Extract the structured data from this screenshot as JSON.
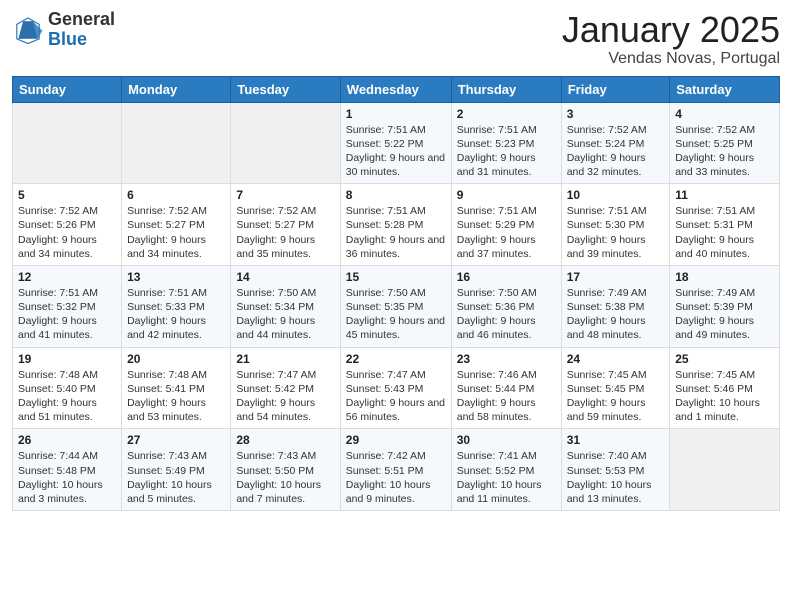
{
  "header": {
    "logo_general": "General",
    "logo_blue": "Blue",
    "title": "January 2025",
    "location": "Vendas Novas, Portugal"
  },
  "weekdays": [
    "Sunday",
    "Monday",
    "Tuesday",
    "Wednesday",
    "Thursday",
    "Friday",
    "Saturday"
  ],
  "weeks": [
    [
      {
        "day": "",
        "content": ""
      },
      {
        "day": "",
        "content": ""
      },
      {
        "day": "",
        "content": ""
      },
      {
        "day": "1",
        "content": "Sunrise: 7:51 AM\nSunset: 5:22 PM\nDaylight: 9 hours and 30 minutes."
      },
      {
        "day": "2",
        "content": "Sunrise: 7:51 AM\nSunset: 5:23 PM\nDaylight: 9 hours and 31 minutes."
      },
      {
        "day": "3",
        "content": "Sunrise: 7:52 AM\nSunset: 5:24 PM\nDaylight: 9 hours and 32 minutes."
      },
      {
        "day": "4",
        "content": "Sunrise: 7:52 AM\nSunset: 5:25 PM\nDaylight: 9 hours and 33 minutes."
      }
    ],
    [
      {
        "day": "5",
        "content": "Sunrise: 7:52 AM\nSunset: 5:26 PM\nDaylight: 9 hours and 34 minutes."
      },
      {
        "day": "6",
        "content": "Sunrise: 7:52 AM\nSunset: 5:27 PM\nDaylight: 9 hours and 34 minutes."
      },
      {
        "day": "7",
        "content": "Sunrise: 7:52 AM\nSunset: 5:27 PM\nDaylight: 9 hours and 35 minutes."
      },
      {
        "day": "8",
        "content": "Sunrise: 7:51 AM\nSunset: 5:28 PM\nDaylight: 9 hours and 36 minutes."
      },
      {
        "day": "9",
        "content": "Sunrise: 7:51 AM\nSunset: 5:29 PM\nDaylight: 9 hours and 37 minutes."
      },
      {
        "day": "10",
        "content": "Sunrise: 7:51 AM\nSunset: 5:30 PM\nDaylight: 9 hours and 39 minutes."
      },
      {
        "day": "11",
        "content": "Sunrise: 7:51 AM\nSunset: 5:31 PM\nDaylight: 9 hours and 40 minutes."
      }
    ],
    [
      {
        "day": "12",
        "content": "Sunrise: 7:51 AM\nSunset: 5:32 PM\nDaylight: 9 hours and 41 minutes."
      },
      {
        "day": "13",
        "content": "Sunrise: 7:51 AM\nSunset: 5:33 PM\nDaylight: 9 hours and 42 minutes."
      },
      {
        "day": "14",
        "content": "Sunrise: 7:50 AM\nSunset: 5:34 PM\nDaylight: 9 hours and 44 minutes."
      },
      {
        "day": "15",
        "content": "Sunrise: 7:50 AM\nSunset: 5:35 PM\nDaylight: 9 hours and 45 minutes."
      },
      {
        "day": "16",
        "content": "Sunrise: 7:50 AM\nSunset: 5:36 PM\nDaylight: 9 hours and 46 minutes."
      },
      {
        "day": "17",
        "content": "Sunrise: 7:49 AM\nSunset: 5:38 PM\nDaylight: 9 hours and 48 minutes."
      },
      {
        "day": "18",
        "content": "Sunrise: 7:49 AM\nSunset: 5:39 PM\nDaylight: 9 hours and 49 minutes."
      }
    ],
    [
      {
        "day": "19",
        "content": "Sunrise: 7:48 AM\nSunset: 5:40 PM\nDaylight: 9 hours and 51 minutes."
      },
      {
        "day": "20",
        "content": "Sunrise: 7:48 AM\nSunset: 5:41 PM\nDaylight: 9 hours and 53 minutes."
      },
      {
        "day": "21",
        "content": "Sunrise: 7:47 AM\nSunset: 5:42 PM\nDaylight: 9 hours and 54 minutes."
      },
      {
        "day": "22",
        "content": "Sunrise: 7:47 AM\nSunset: 5:43 PM\nDaylight: 9 hours and 56 minutes."
      },
      {
        "day": "23",
        "content": "Sunrise: 7:46 AM\nSunset: 5:44 PM\nDaylight: 9 hours and 58 minutes."
      },
      {
        "day": "24",
        "content": "Sunrise: 7:45 AM\nSunset: 5:45 PM\nDaylight: 9 hours and 59 minutes."
      },
      {
        "day": "25",
        "content": "Sunrise: 7:45 AM\nSunset: 5:46 PM\nDaylight: 10 hours and 1 minute."
      }
    ],
    [
      {
        "day": "26",
        "content": "Sunrise: 7:44 AM\nSunset: 5:48 PM\nDaylight: 10 hours and 3 minutes."
      },
      {
        "day": "27",
        "content": "Sunrise: 7:43 AM\nSunset: 5:49 PM\nDaylight: 10 hours and 5 minutes."
      },
      {
        "day": "28",
        "content": "Sunrise: 7:43 AM\nSunset: 5:50 PM\nDaylight: 10 hours and 7 minutes."
      },
      {
        "day": "29",
        "content": "Sunrise: 7:42 AM\nSunset: 5:51 PM\nDaylight: 10 hours and 9 minutes."
      },
      {
        "day": "30",
        "content": "Sunrise: 7:41 AM\nSunset: 5:52 PM\nDaylight: 10 hours and 11 minutes."
      },
      {
        "day": "31",
        "content": "Sunrise: 7:40 AM\nSunset: 5:53 PM\nDaylight: 10 hours and 13 minutes."
      },
      {
        "day": "",
        "content": ""
      }
    ]
  ]
}
